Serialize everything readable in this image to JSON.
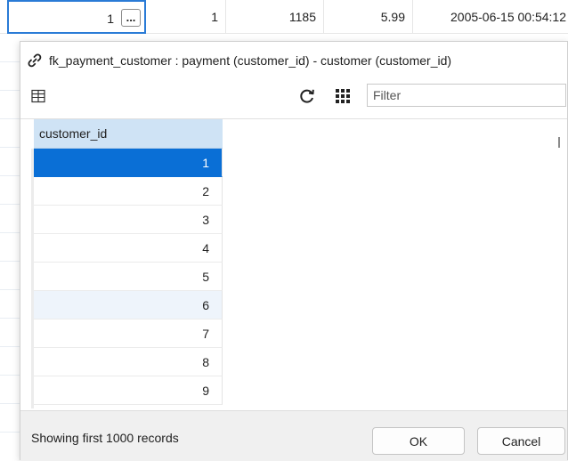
{
  "background_row": {
    "cells": [
      {
        "value": "1"
      },
      {
        "value": "1"
      },
      {
        "value": "1185"
      },
      {
        "value": "5.99"
      },
      {
        "value": "2005-06-15 00:54:12"
      }
    ],
    "ellipsis_label": "..."
  },
  "popup": {
    "title": "fk_payment_customer : payment (customer_id) - customer (customer_id)",
    "filter_placeholder": "Filter",
    "column_header": "customer_id",
    "rows": [
      "1",
      "2",
      "3",
      "4",
      "5",
      "6",
      "7",
      "8",
      "9"
    ],
    "selected_row": "1",
    "status": "Showing first 1000 records",
    "ok_label": "OK",
    "cancel_label": "Cancel"
  },
  "colors": {
    "selection": "#0a6fd6",
    "header_bg": "#cfe3f5",
    "active_cell_border": "#2a7bd6"
  },
  "icons": [
    "link-icon",
    "columns-icon",
    "refresh-icon",
    "grid-icon",
    "ellipsis-icon"
  ]
}
